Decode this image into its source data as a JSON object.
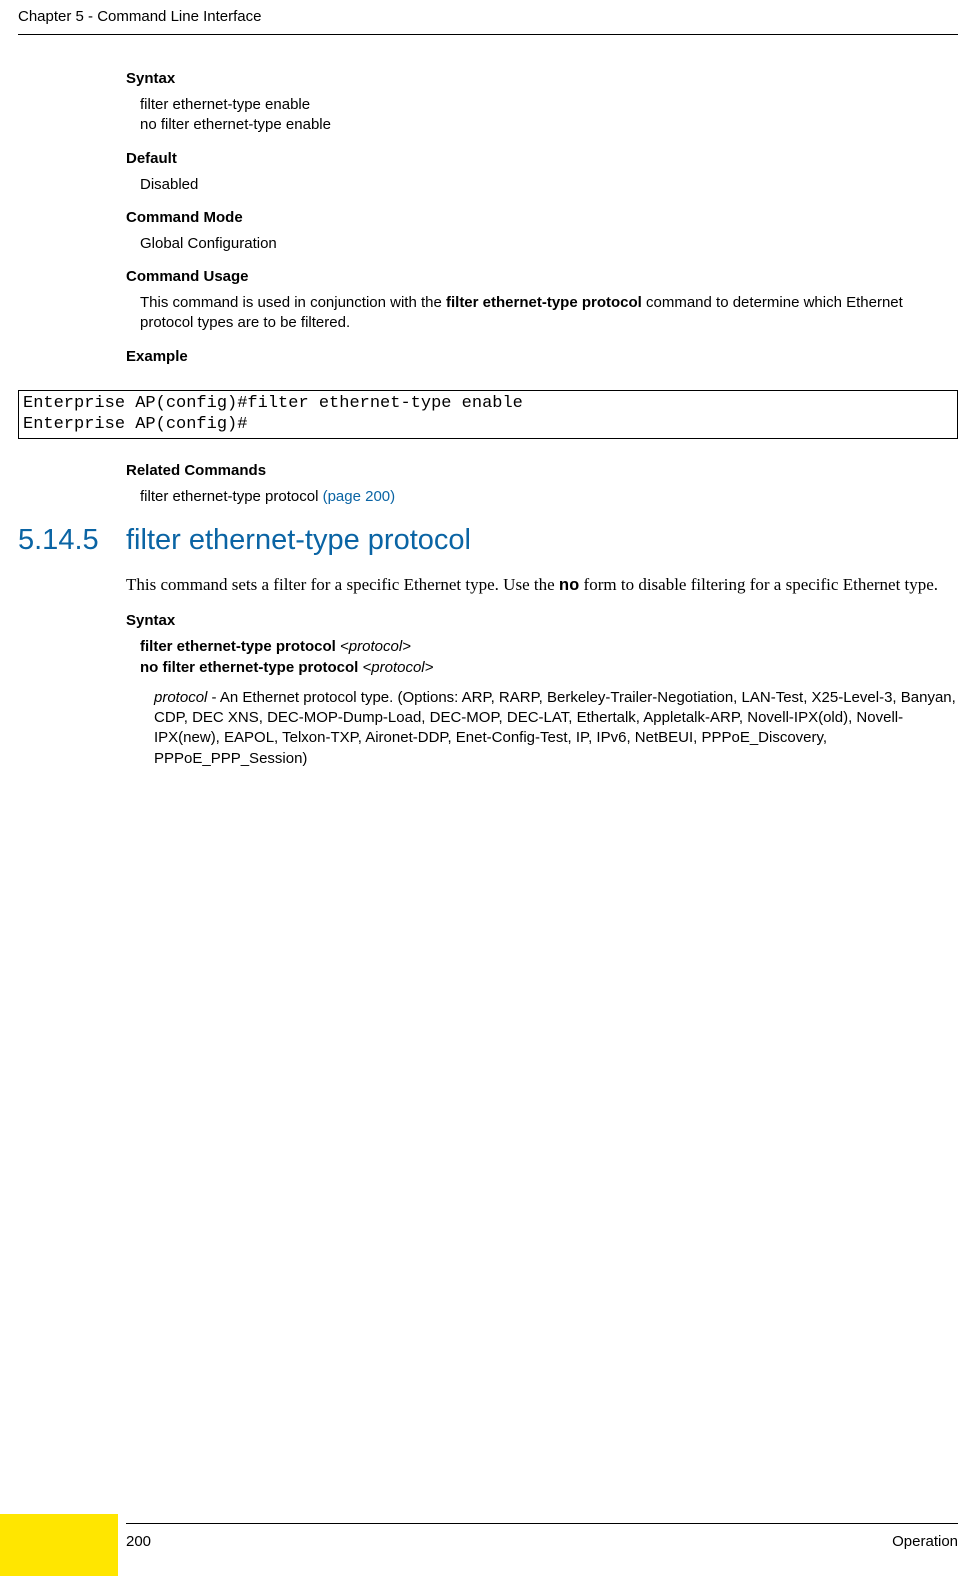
{
  "header": {
    "running": "Chapter 5 - Command Line Interface"
  },
  "sec1": {
    "syntax_label": "Syntax",
    "syntax_l1": "filter ethernet-type enable",
    "syntax_l2": "no filter ethernet-type enable",
    "default_label": "Default",
    "default_val": "Disabled",
    "mode_label": "Command Mode",
    "mode_val": "Global Configuration",
    "usage_label": "Command Usage",
    "usage_pre": "This command is used in conjunction with the ",
    "usage_bold": "filter ethernet-type protocol",
    "usage_post": " command to determine which Ethernet protocol types are to be filtered.",
    "example_label": "Example",
    "code": "Enterprise AP(config)#filter ethernet-type enable\nEnterprise AP(config)#",
    "related_label": "Related Commands",
    "related_text": "filter ethernet-type protocol ",
    "related_link": "(page 200)"
  },
  "sec2": {
    "number": "5.14.5",
    "title": "filter ethernet-type protocol",
    "intro_pre": "This command sets a filter for a specific Ethernet type. Use the ",
    "intro_bold": "no",
    "intro_post": " form to disable filtering for a specific Ethernet type.",
    "syntax_label": "Syntax",
    "s_l1_b": "filter ethernet-type protocol ",
    "s_l1_i": "<protocol>",
    "s_l2_b": "no filter ethernet-type protocol ",
    "s_l2_i": "<protocol>",
    "opt_i": "protocol",
    "opt_rest": " - An Ethernet protocol type. (Options: ARP, RARP, Berkeley-Trailer-Negotiation, LAN-Test, X25-Level-3, Banyan, CDP, DEC XNS, DEC-MOP-Dump-Load, DEC-MOP, DEC-LAT, Ethertalk, Appletalk-ARP, Novell-IPX(old), Novell-IPX(new), EAPOL, Telxon-TXP, Aironet-DDP, Enet-Config-Test, IP, IPv6, NetBEUI, PPPoE_Discovery, PPPoE_PPP_Session)"
  },
  "footer": {
    "page": "200",
    "right": "Operation"
  }
}
